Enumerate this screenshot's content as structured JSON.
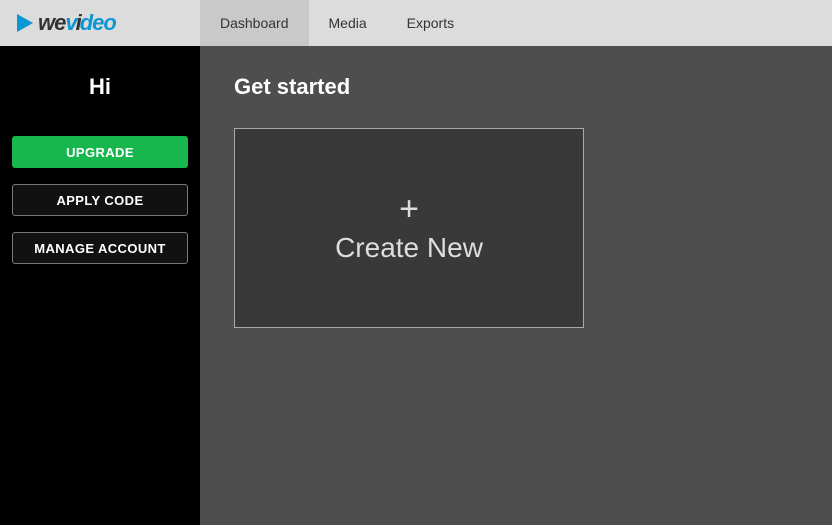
{
  "brand": {
    "name": "WeVideo",
    "part_a": "we",
    "part_b": "v",
    "part_c": "deo"
  },
  "nav": {
    "tabs": [
      {
        "label": "Dashboard",
        "active": true
      },
      {
        "label": "Media",
        "active": false
      },
      {
        "label": "Exports",
        "active": false
      }
    ]
  },
  "sidebar": {
    "greeting": "Hi",
    "buttons": {
      "upgrade": "UPGRADE",
      "apply_code": "APPLY CODE",
      "manage_account": "MANAGE ACCOUNT"
    }
  },
  "main": {
    "section_title": "Get started",
    "create_card": {
      "plus": "+",
      "label": "Create New"
    }
  },
  "colors": {
    "brand_blue": "#0b97d4",
    "upgrade_green": "#18b74d",
    "main_bg": "#4e4e4e",
    "card_bg": "#393939"
  }
}
